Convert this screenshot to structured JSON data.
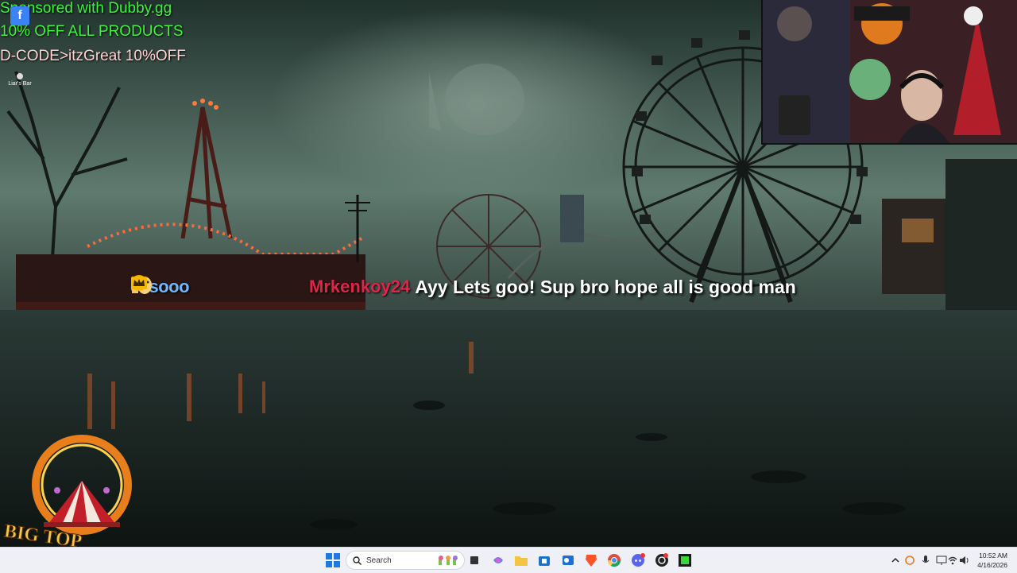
{
  "overlay": {
    "sponsor_line_1": "Sponsored with Dubby.gg",
    "sponsor_line_2": "10% OFF ALL PRODUCTS",
    "sponsor_line_3": "D-CODE>itzGreat 10%OFF"
  },
  "desktop": {
    "icons": [
      {
        "label": "",
        "icon": "facebook-icon"
      },
      {
        "label": "Liar's Bar",
        "icon": "app-icon"
      }
    ]
  },
  "chat": {
    "previous_fragment": "essooo",
    "username": "Mrkenkoy24",
    "message": "Ayy Lets goo! Sup bro hope all is good man",
    "username_color": "#e2234a",
    "badges": [
      "plus-badge-icon",
      "number-one-badge-icon",
      "crown-badge-icon"
    ]
  },
  "logo": {
    "text": "BIG TOP"
  },
  "taskbar": {
    "search_placeholder": "Search",
    "pinned_apps": [
      "start-icon",
      "search-icon",
      "widgets-icon",
      "file-explorer-icon",
      "copilot-icon",
      "folder-icon",
      "store-icon",
      "outlook-icon",
      "brave-icon",
      "chrome-icon",
      "discord-icon",
      "obs-icon",
      "terminal-icon"
    ],
    "tray_icons": [
      "chevron-up-icon",
      "refresh-icon",
      "microphone-icon",
      "display-icon",
      "wifi-icon",
      "volume-icon"
    ],
    "time": "10:52 AM",
    "date": "4/16/2026"
  }
}
